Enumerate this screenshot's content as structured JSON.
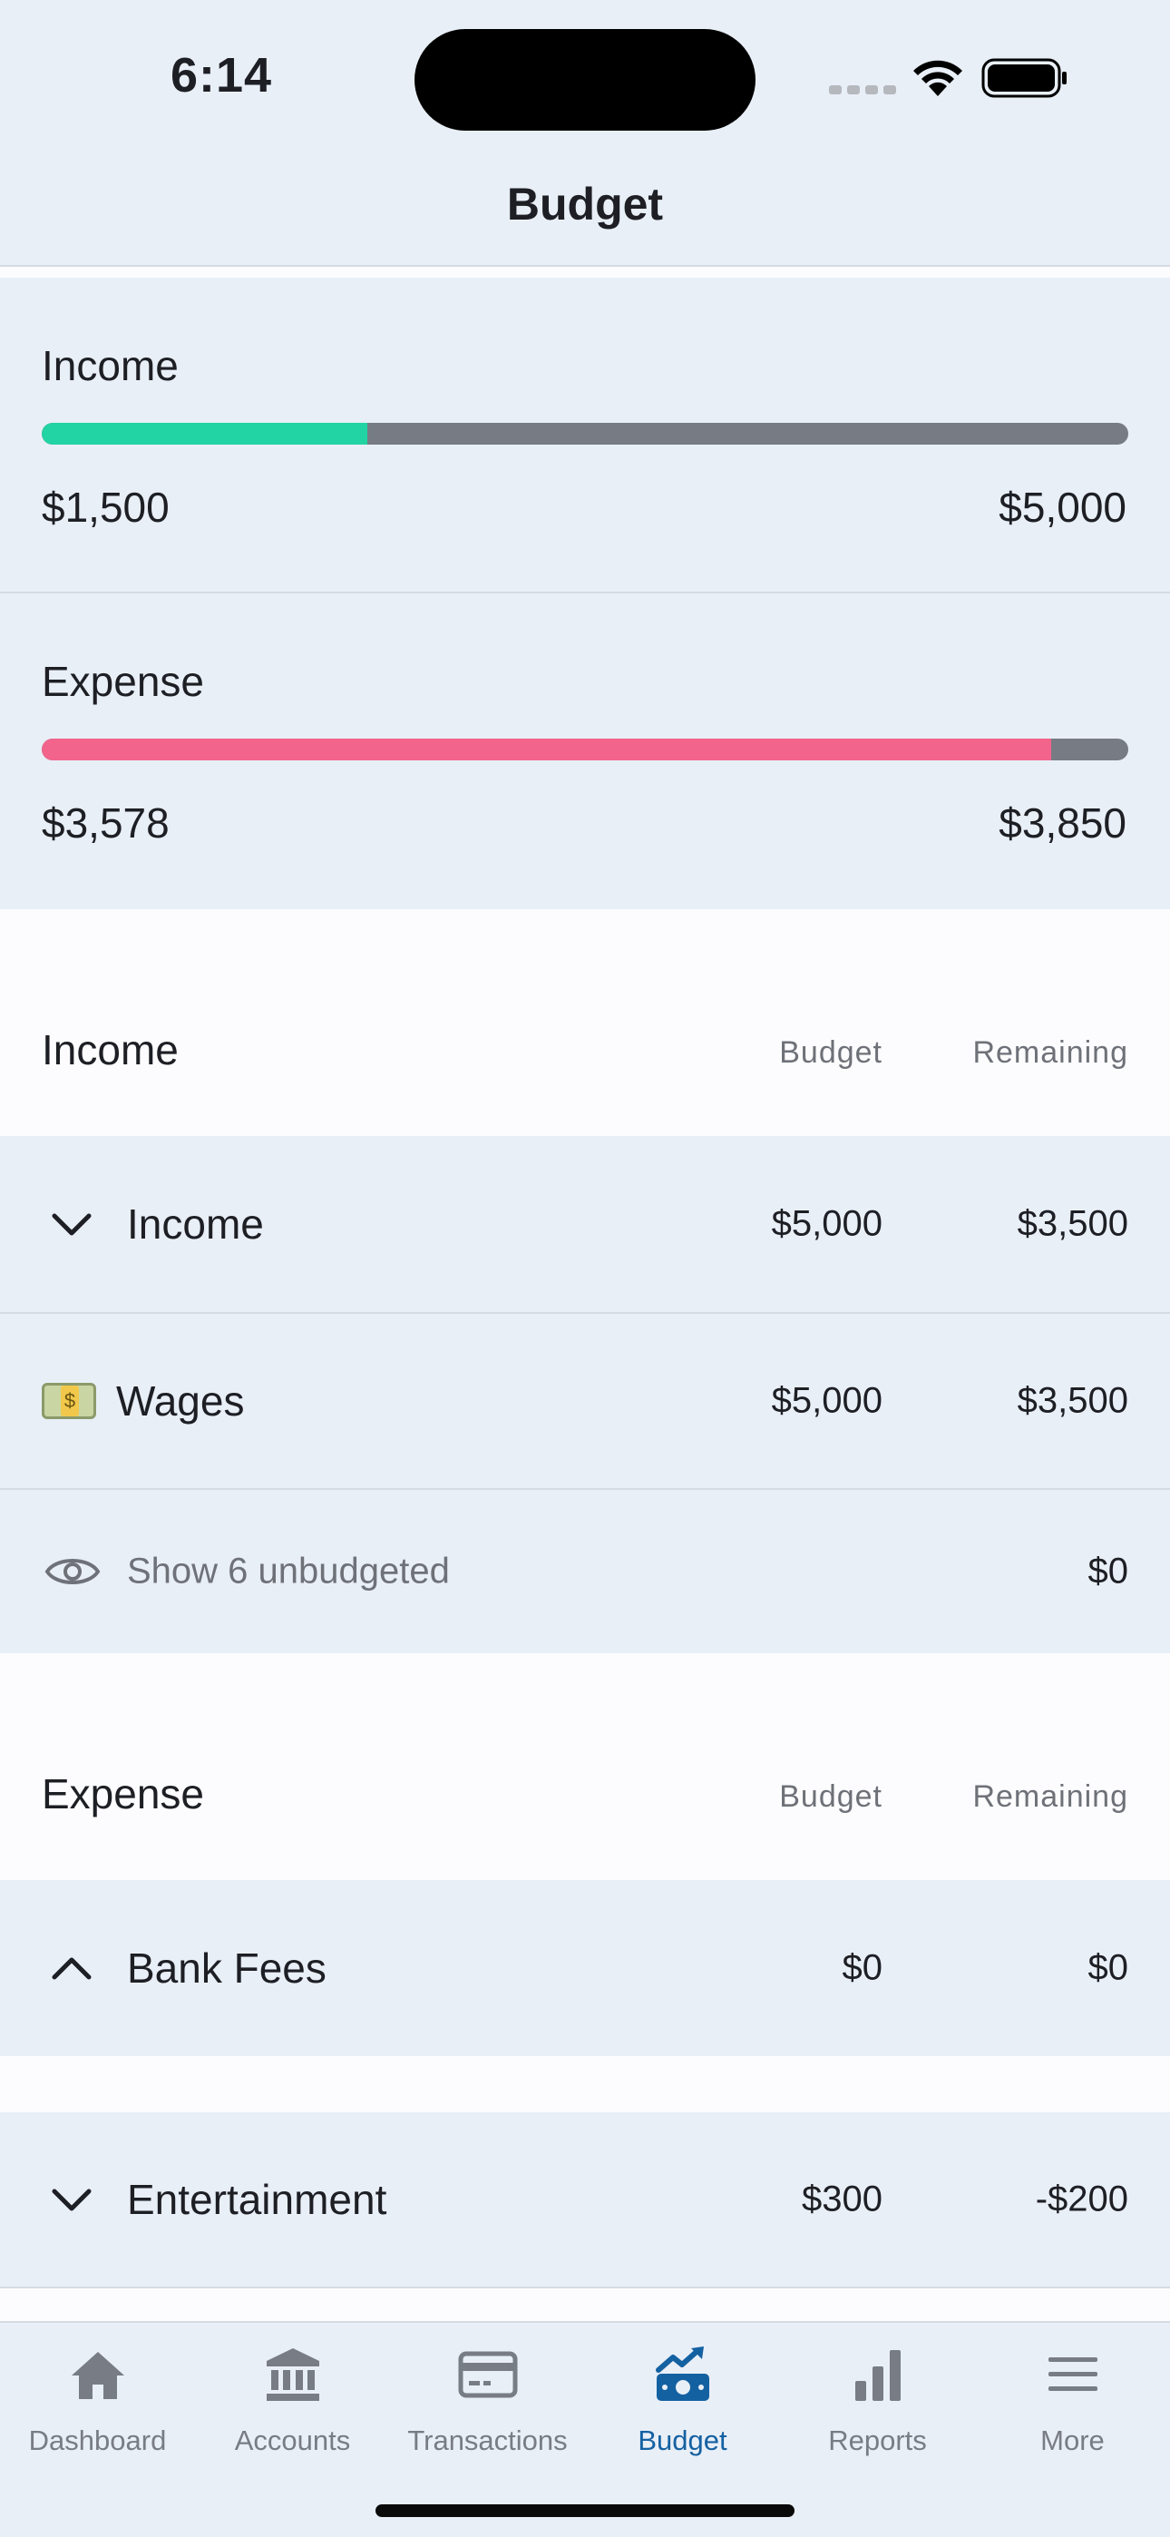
{
  "status_bar": {
    "time": "6:14"
  },
  "header": {
    "title": "Budget"
  },
  "summary": {
    "income": {
      "label": "Income",
      "current": "$1,500",
      "target": "$5,000",
      "progress": 0.3,
      "color": "#22d3a4"
    },
    "expense": {
      "label": "Expense",
      "current": "$3,578",
      "target": "$3,850",
      "progress": 0.929,
      "color": "#f2648c"
    }
  },
  "income_section": {
    "title": "Income",
    "col_budget": "Budget",
    "col_remaining": "Remaining",
    "group": {
      "label": "Income",
      "budget": "$5,000",
      "remaining": "$3,500"
    },
    "item": {
      "label": "Wages",
      "budget": "$5,000",
      "remaining": "$3,500",
      "icon": "money-bill-emoji"
    },
    "unbudgeted": {
      "label": "Show 6 unbudgeted",
      "value": "$0"
    }
  },
  "expense_section": {
    "title": "Expense",
    "col_budget": "Budget",
    "col_remaining": "Remaining",
    "groups": [
      {
        "label": "Bank Fees",
        "budget": "$0",
        "remaining": "$0",
        "expanded": true
      },
      {
        "label": "Entertainment",
        "budget": "$300",
        "remaining": "-$200",
        "expanded": false
      }
    ]
  },
  "tabs": [
    {
      "label": "Dashboard",
      "icon": "home-icon"
    },
    {
      "label": "Accounts",
      "icon": "bank-icon"
    },
    {
      "label": "Transactions",
      "icon": "credit-card-icon"
    },
    {
      "label": "Budget",
      "icon": "money-chart-icon",
      "active": true
    },
    {
      "label": "Reports",
      "icon": "bar-chart-icon"
    },
    {
      "label": "More",
      "icon": "menu-icon"
    }
  ],
  "colors": {
    "accent": "#1461a2",
    "background": "#e9eff7"
  }
}
